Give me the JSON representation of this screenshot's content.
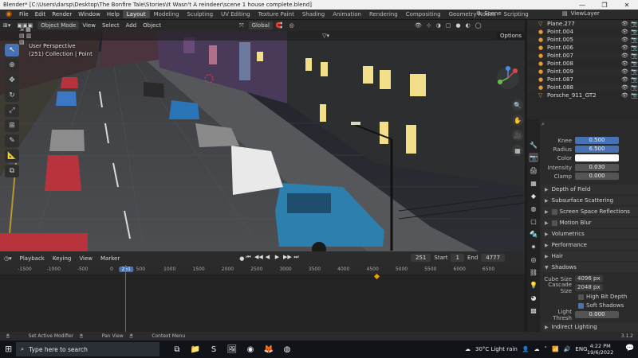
{
  "window": {
    "title": "Blender* [C:\\Users\\darsp\\Desktop\\The Bonfire Tale\\Stories\\It Wasn't A reindeer\\scene 1 house complete.blend]",
    "controls": [
      "—",
      "❐",
      "✕"
    ]
  },
  "menubar": {
    "menus": [
      "File",
      "Edit",
      "Render",
      "Window",
      "Help"
    ],
    "workspaces": [
      "Layout",
      "Modeling",
      "Sculpting",
      "UV Editing",
      "Texture Paint",
      "Shading",
      "Animation",
      "Rendering",
      "Compositing",
      "Geometry Nodes",
      "Scripting"
    ],
    "active_workspace": "Layout",
    "scene": "Scene",
    "view_layer": "ViewLayer"
  },
  "viewport": {
    "mode": "Object Mode",
    "menus": [
      "View",
      "Select",
      "Add",
      "Object"
    ],
    "orientation": "Global",
    "options": "Options",
    "overlay_line1": "User Perspective",
    "overlay_line2": "(251) Collection | Point"
  },
  "timeline": {
    "menus": [
      "Playback",
      "Keying",
      "View",
      "Marker"
    ],
    "current_frame": "251",
    "start_label": "Start",
    "start": "1",
    "end_label": "End",
    "end": "4777",
    "ruler": [
      "-1500",
      "-1000",
      "-500",
      "0",
      "251",
      "500",
      "1000",
      "1500",
      "2000",
      "2500",
      "3000",
      "3500",
      "4000",
      "4500",
      "5000",
      "5500",
      "6000",
      "6500"
    ]
  },
  "outliner": {
    "items": [
      "Plane.277",
      "Point.004",
      "Point.005",
      "Point.006",
      "Point.007",
      "Point.008",
      "Point.009",
      "Point.087",
      "Point.088",
      "Porsche_911_GT2"
    ]
  },
  "properties": {
    "knee": {
      "label": "Knee",
      "value": "0.500"
    },
    "radius": {
      "label": "Radius",
      "value": "6.500"
    },
    "color": {
      "label": "Color"
    },
    "intensity": {
      "label": "Intensity",
      "value": "0.030"
    },
    "clamp": {
      "label": "Clamp",
      "value": "0.000"
    },
    "sections": [
      "Depth of Field",
      "Subsurface Scattering",
      "Screen Space Reflections",
      "Motion Blur",
      "Volumetrics",
      "Performance",
      "Hair",
      "Shadows"
    ],
    "cube_size": {
      "label": "Cube Size",
      "value": "4096 px"
    },
    "cascade_size": {
      "label": "Cascade Size",
      "value": "2048 px"
    },
    "high_bit_depth": "High Bit Depth",
    "soft_shadows": "Soft Shadows",
    "light_thresh": {
      "label": "Light Thresh",
      "value": "0.000"
    },
    "indirect_lighting": "Indirect Lighting"
  },
  "statusbar": {
    "items": [
      "Set Active Modifier",
      "Pan View",
      "Context Menu"
    ],
    "version": "3.1.2"
  },
  "taskbar": {
    "search_placeholder": "Type here to search",
    "weather": "30°C  Light rain",
    "language": "ENG",
    "time": "4:22 PM",
    "date": "19/6/2022"
  }
}
